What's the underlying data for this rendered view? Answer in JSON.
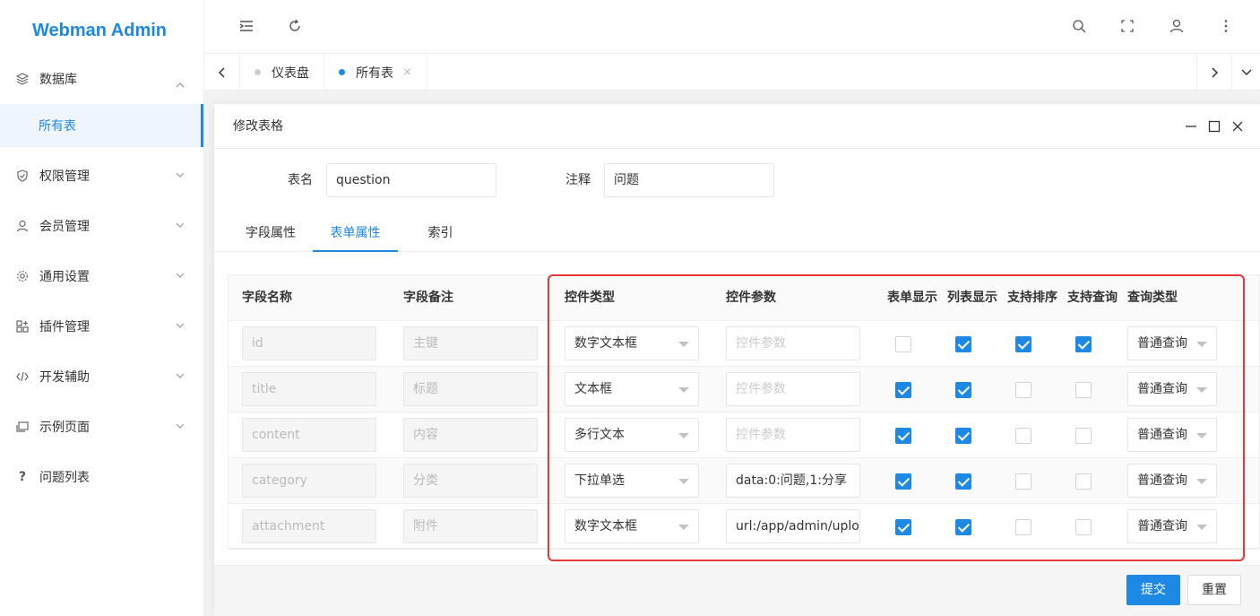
{
  "app": {
    "title": "Webman Admin"
  },
  "sidebar": {
    "items": [
      {
        "label": "数据库",
        "icon": "layers-icon"
      },
      {
        "label": "所有表",
        "icon": ""
      },
      {
        "label": "权限管理",
        "icon": "shield-icon"
      },
      {
        "label": "会员管理",
        "icon": "user-icon"
      },
      {
        "label": "通用设置",
        "icon": "gear-icon"
      },
      {
        "label": "插件管理",
        "icon": "apps-icon"
      },
      {
        "label": "开发辅助",
        "icon": "code-icon"
      },
      {
        "label": "示例页面",
        "icon": "template-icon"
      },
      {
        "label": "问题列表",
        "icon": "question-icon"
      }
    ]
  },
  "tabs": [
    {
      "label": "仪表盘"
    },
    {
      "label": "所有表",
      "close": "×"
    }
  ],
  "dialog": {
    "title": "修改表格",
    "table_name_label": "表名",
    "table_name_value": "question",
    "comment_label": "注释",
    "comment_value": "问题",
    "tabs": [
      "字段属性",
      "表单属性",
      "索引"
    ],
    "columns": [
      "字段名称",
      "字段备注",
      "控件类型",
      "控件参数",
      "表单显示",
      "列表显示",
      "支持排序",
      "支持查询",
      "查询类型"
    ],
    "rows": [
      {
        "field": "id",
        "note": "主键",
        "control": "数字文本框",
        "param": "",
        "param_placeholder": "控件参数",
        "form": false,
        "list": true,
        "sort": true,
        "search": true,
        "query": "普通查询"
      },
      {
        "field": "title",
        "note": "标题",
        "control": "文本框",
        "param": "",
        "param_placeholder": "控件参数",
        "form": true,
        "list": true,
        "sort": false,
        "search": false,
        "query": "普通查询"
      },
      {
        "field": "content",
        "note": "内容",
        "control": "多行文本",
        "param": "",
        "param_placeholder": "控件参数",
        "form": true,
        "list": true,
        "sort": false,
        "search": false,
        "query": "普通查询"
      },
      {
        "field": "category",
        "note": "分类",
        "control": "下拉单选",
        "param": "data:0:问题,1:分享",
        "param_placeholder": "",
        "form": true,
        "list": true,
        "sort": false,
        "search": false,
        "query": "普通查询"
      },
      {
        "field": "attachment",
        "note": "附件",
        "control": "数字文本框",
        "param": "url:/app/admin/upload",
        "param_placeholder": "",
        "form": true,
        "list": true,
        "sort": false,
        "search": false,
        "query": "普通查询"
      }
    ],
    "submit_label": "提交",
    "reset_label": "重置"
  },
  "colors": {
    "accent": "#1e88e5",
    "highlight": "#e53935"
  }
}
